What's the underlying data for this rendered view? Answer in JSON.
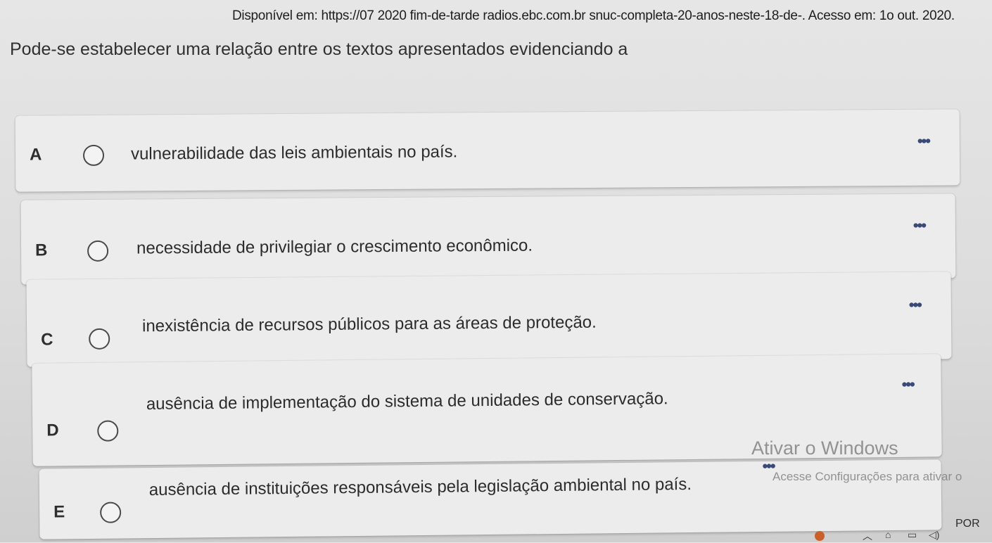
{
  "header": {
    "source": "Disponível em: https://07 2020 fim-de-tarde radios.ebc.com.br snuc-completa-20-anos-neste-18-de-. Acesso em: 1o out. 2020."
  },
  "question": {
    "text": "Pode-se estabelecer uma relação entre os textos apresentados evidenciando a"
  },
  "options": [
    {
      "letter": "A",
      "text": "vulnerabilidade das leis ambientais no país."
    },
    {
      "letter": "B",
      "text": "necessidade de privilegiar o crescimento econômico."
    },
    {
      "letter": "C",
      "text": "inexistência de recursos públicos para as áreas de proteção."
    },
    {
      "letter": "D",
      "text": "ausência de implementação do sistema de unidades de conservação."
    },
    {
      "letter": "E",
      "text": "ausência de instituições responsáveis pela legislação ambiental no país."
    }
  ],
  "more_label": "•••",
  "watermark": {
    "title": "Ativar o Windows",
    "subtitle": "Acesse Configurações para ativar o"
  },
  "taskbar": {
    "language": "POR",
    "icons": [
      "chevron-up-icon",
      "network-icon",
      "battery-icon",
      "volume-icon"
    ]
  },
  "colors": {
    "card": "#ececec",
    "more_dots": "#3a4a78"
  }
}
